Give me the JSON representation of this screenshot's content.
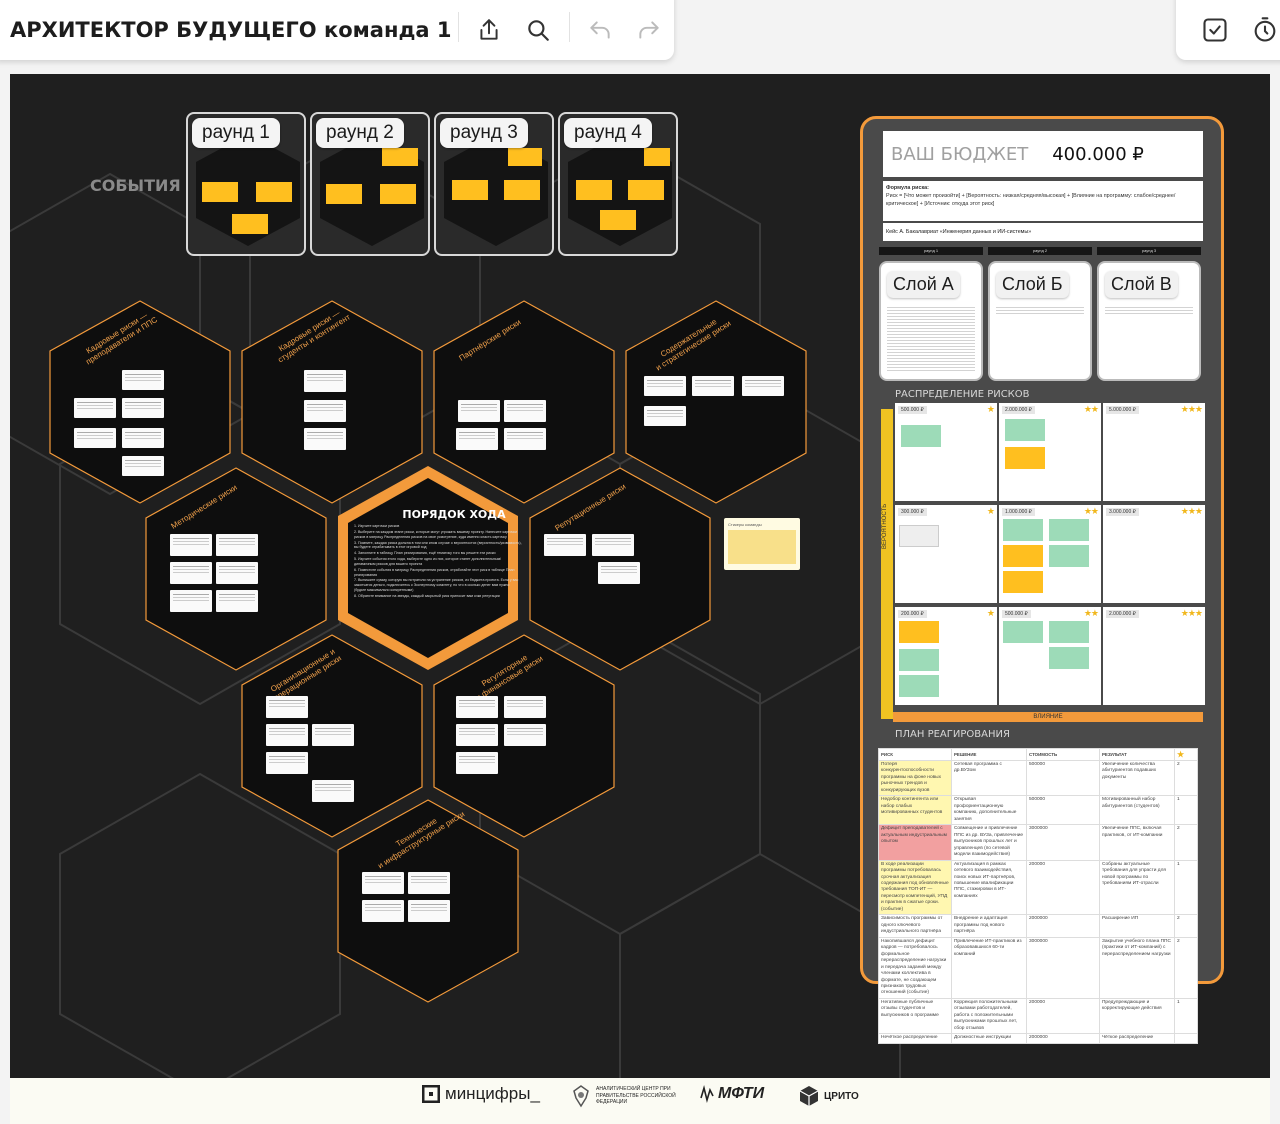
{
  "toolbar": {
    "board_title": "АРХИТЕКТОР БУДУЩЕГО команда 1",
    "icons": [
      "share-icon",
      "search-icon",
      "undo-icon",
      "redo-icon",
      "checkbox-icon",
      "timer-icon"
    ]
  },
  "events": {
    "label": "СОБЫТИЯ",
    "rounds": [
      "раунд 1",
      "раунд 2",
      "раунд 3",
      "раунд 4"
    ]
  },
  "hexes": {
    "cadre_teachers": "Кадровые риски —\nпреподаватели и ППС",
    "cadre_students": "Кадровые риски —\nстуденты и контингент",
    "partner": "Партнёрские риски",
    "content": "Содержательные\nи стратегические риски",
    "methodical": "Методические риски",
    "reputation": "Репутационные риски",
    "org": "Организационные и\nоперационные риски",
    "finance": "Регуляторные\nи финансовые риски",
    "tech": "Технические\nи инфраструктурные риски"
  },
  "order": {
    "title": "ПОРЯДОК ХОДА",
    "steps": [
      "1. Изучите карточки рисков",
      "2. Выберите на каждом этапе риски, которые могут угрожать вашему проекту. Нанесите карточки рисков в матрицу Распределения рисков на свое усмотрение, куда именно класть карточку",
      "3. Помните, каждая риска должна в том или ином случае о вероятностях (вероятность/уязвимость), вы будете отрабатывать в этот игровой ход",
      "4. Заполните в таблицу План реагирования, ещё тематику того вы решите эти риски",
      "5. Изучите события этого хода, выберите одно из них, которое станет дополнительным/динамичным рисков для вашего проекта",
      "6. Поместите события в матрицу Распределения рисков, отработайте этот риск в таблице План реагирования",
      "7. Выпишите сумму, которую вы потратили на устранение рисков, из бюджета проекта. Если у вас закончатся деньги, подключитесь к Экспертному комитету, но что в сколько денег вам нужно (будьте максимально конкретными)",
      "8. Обратите внимание на звезды, каждый закрытый риск приносит вам очки репутации"
    ]
  },
  "sticky_note": {
    "label": "Стикеры команды"
  },
  "budget": {
    "label": "ВАШ БЮДЖЕТ",
    "value": "400.000 ₽",
    "formula_title": "Формула риска:",
    "formula": "Риск = [Что может произойти] + [Вероятность: низкая/средняя/высокая] + [Влияние на программу: слабое/среднее/критическое] + [Источник: откуда этот риск]",
    "case": "Кейс А. Бакалавриат «Инженерия данных и ИИ-системы»"
  },
  "layers": {
    "round_labels": [
      "раунд 1",
      "раунд 2",
      "раунд 3"
    ],
    "cards": [
      "Слой А",
      "Слой Б",
      "Слой В"
    ]
  },
  "risk_matrix": {
    "title": "РАСПРЕДЕЛЕНИЕ РИСКОВ",
    "y_axis": "ВЕРОЯТНОСТЬ",
    "x_axis": "ВЛИЯНИЕ",
    "rows": [
      [
        {
          "value": "500.000 ₽",
          "stars": "★"
        },
        {
          "value": "2.000.000 ₽",
          "stars": "★★"
        },
        {
          "value": "5.000.000 ₽",
          "stars": "★★★"
        }
      ],
      [
        {
          "value": "300.000 ₽",
          "stars": "★"
        },
        {
          "value": "1.000.000 ₽",
          "stars": "★★"
        },
        {
          "value": "3.000.000 ₽",
          "stars": "★★★"
        }
      ],
      [
        {
          "value": "200.000 ₽",
          "stars": "★"
        },
        {
          "value": "500.000 ₽",
          "stars": "★★"
        },
        {
          "value": "2.000.000 ₽",
          "stars": "★★★"
        }
      ]
    ]
  },
  "plan": {
    "title": "ПЛАН РЕАГИРОВАНИЯ",
    "headers": [
      "РИСК",
      "РЕШЕНИЕ",
      "СТОИМОСТЬ",
      "РЕЗУЛЬТАТ",
      "★"
    ],
    "rows": [
      [
        "Потеря конкурентоспособности программы на фоне новых рыночных трендов и конкурирующих вузов",
        "Сетевая программа с др.ВУЗом",
        "500000",
        "Увеличение количества абитуриентов подавших документы",
        "2"
      ],
      [
        "Недобор контингента или набор слабых мотивированных студентов",
        "Открывая профориентационную компанию, дополнительные занятия",
        "500000",
        "Мотивированный набор абитуриентов (студентов)",
        "1"
      ],
      [
        "Дефицит преподавателей с актуальным индустриальным опытом",
        "Совмещение и привлечение ППС из др. ВУЗа, привлечение выпускников прошлых лет и управленцев (по сетевой модели взаимодействия)",
        "3000000",
        "Увеличение ППС, включая практиков, от ИТ-компании",
        "2"
      ],
      [
        "В ходе реализации программы потребовалась срочная актуализация содержания под обновлённые требования ТОП-ИТ — пересмотр компетенций, УПД и практик в сжатые сроки. (событие)",
        "Актуализация в рамках сетевого взаимодействия, поиск новых ИТ-партнёров, повышение квалификации ППС, стажировки в ИТ-компаниях",
        "200000",
        "Собраны актуальные требования для упрасти для новой программы по требованиям ИТ-отрасли",
        "1"
      ],
      [
        "Зависимость программы от одного ключевого индустриального партнёра",
        "Внедрение и адаптация программы под нового партнёра",
        "2000000",
        "Расширение ИП",
        "2"
      ],
      [
        "Накопившаяся дефицит кадров — потребовалось формальное перераспределение нагрузки и передача заданий между членами коллектива в формате, не создающем признаков трудовых отношений (событие)",
        "Привлечение ИТ-практиков из образовавшихся 60-ти компаний",
        "3000000",
        "Закрытие учебного плана ППС (практики от ИТ-компаний) с перераспределением нагрузки",
        "2"
      ],
      [
        "Негативные публичные отзывы студентов и выпускников о программе",
        "Коррекция положительными отзывами работодателей, работа с положительными выпускниками прошлых лет, сбор отзывов",
        "200000",
        "Предупреждающие и корректирующие действия",
        "1"
      ],
      [
        "Нечёткое распределение",
        "Должностные инструкции",
        "2000000",
        "Чёткое распределение",
        ""
      ]
    ]
  },
  "footer": {
    "logos": [
      "минцифры_",
      "АНАЛИТИЧЕСКИЙ ЦЕНТР ПРИ ПРАВИТЕЛЬСТВЕ РОССИЙСКОЙ ФЕДЕРАЦИИ",
      "МФТИ",
      "ЦРИТО"
    ]
  }
}
